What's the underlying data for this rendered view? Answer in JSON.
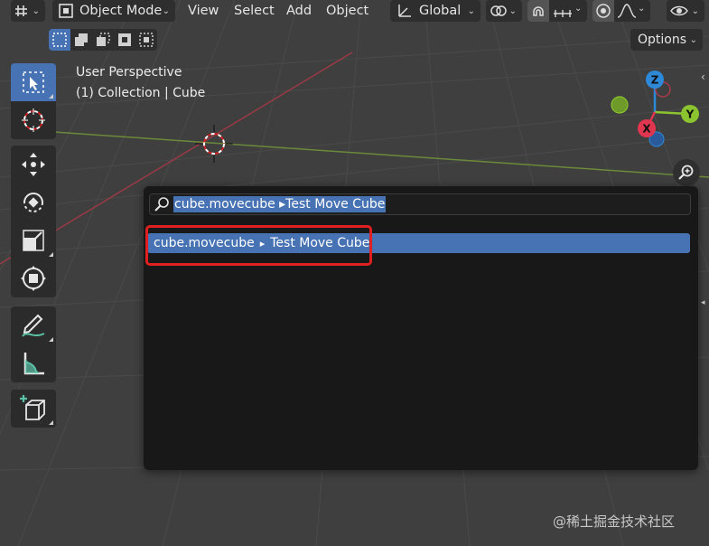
{
  "header": {
    "mode": "Object Mode",
    "menus": [
      "View",
      "Select",
      "Add",
      "Object"
    ],
    "orientation": "Global",
    "options_label": "Options"
  },
  "viewport": {
    "perspective_label": "User Perspective",
    "collection_label": "(1) Collection | Cube"
  },
  "gizmo": {
    "z_label": "Z",
    "y_label": "Y",
    "x_label": "X",
    "x_color": "#e0364f",
    "y_color": "#8bc42e",
    "z_color": "#2d88d8"
  },
  "toolbar": {
    "tools": [
      {
        "name": "select-box-icon",
        "active": true
      },
      {
        "name": "cursor-icon"
      },
      {
        "name": "move-icon"
      },
      {
        "name": "rotate-icon"
      },
      {
        "name": "scale-icon"
      },
      {
        "name": "transform-icon"
      },
      {
        "name": "annotate-icon"
      },
      {
        "name": "measure-icon"
      },
      {
        "name": "add-cube-icon"
      }
    ]
  },
  "search": {
    "query": "cube.movecube ▸Test Move Cube",
    "results": [
      {
        "id": "cube.movecube",
        "separator": "▸",
        "label": "Test Move Cube"
      }
    ]
  },
  "watermark": "@稀土掘金技术社区",
  "colors": {
    "accent": "#4772b3",
    "highlight_border": "#e02020",
    "popup_bg": "#181818",
    "viewport_bg": "#3f3f3f"
  }
}
